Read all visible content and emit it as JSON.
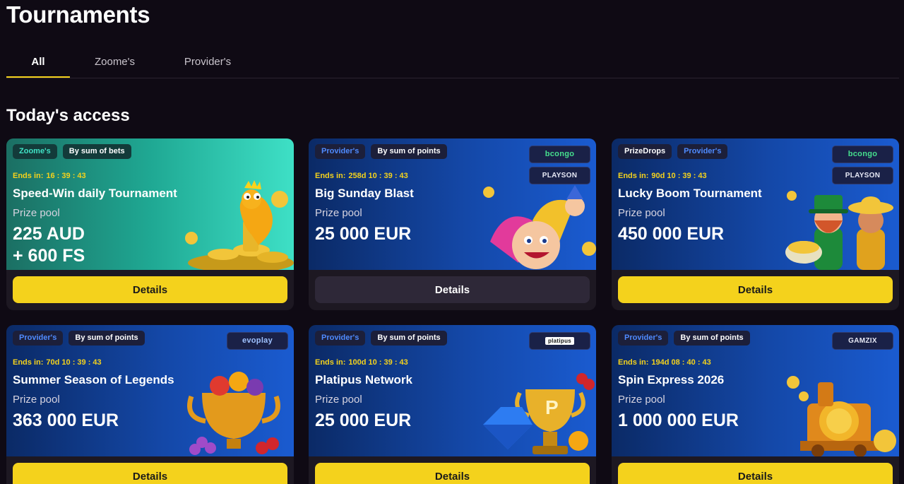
{
  "page": {
    "title": "Tournaments",
    "section_title": "Today's access"
  },
  "tabs": [
    {
      "label": "All",
      "active": true
    },
    {
      "label": "Zoome's",
      "active": false
    },
    {
      "label": "Provider's",
      "active": false
    }
  ],
  "colors": {
    "accent": "#f4d21c",
    "background": "#0f0a14",
    "provider_tag": "#4f8bff",
    "zoome_tag": "#41e3c6"
  },
  "cards": [
    {
      "tags": [
        "Zoome's",
        "By sum of bets"
      ],
      "ends_label": "Ends in:",
      "ends_time": "16 : 39 : 43",
      "title": "Speed-Win daily Tournament",
      "prize_label": "Prize pool",
      "prize_line1": "225 AUD",
      "prize_line2": "+ 600 FS",
      "providers": [],
      "button": "Details",
      "button_style": "primary",
      "art": "gecko-coins-icon"
    },
    {
      "tags": [
        "Provider's",
        "By sum of points"
      ],
      "ends_label": "Ends in:",
      "ends_time": "258d 10 : 39 : 43",
      "title": "Big Sunday Blast",
      "prize_label": "Prize pool",
      "prize_line1": "25 000 EUR",
      "prize_line2": "",
      "providers": [
        "bcongo",
        "PLAYSON"
      ],
      "button": "Details",
      "button_style": "secondary",
      "art": "jester-icon"
    },
    {
      "tags": [
        "PrizeDrops",
        "Provider's"
      ],
      "ends_label": "Ends in:",
      "ends_time": "90d 10 : 39 : 43",
      "title": "Lucky Boom Tournament",
      "prize_label": "Prize pool",
      "prize_line1": "450 000 EUR",
      "prize_line2": "",
      "providers": [
        "bcongo",
        "PLAYSON"
      ],
      "button": "Details",
      "button_style": "primary",
      "art": "leprechaun-icon"
    },
    {
      "tags": [
        "Provider's",
        "By sum of points"
      ],
      "ends_label": "Ends in:",
      "ends_time": "70d 10 : 39 : 43",
      "title": "Summer Season of Legends",
      "prize_label": "Prize pool",
      "prize_line1": "363 000 EUR",
      "prize_line2": "",
      "providers": [
        "evoplay"
      ],
      "button": "Details",
      "button_style": "primary",
      "art": "fruit-trophy-icon"
    },
    {
      "tags": [
        "Provider's",
        "By sum of points"
      ],
      "ends_label": "Ends in:",
      "ends_time": "100d 10 : 39 : 43",
      "title": "Platipus Network",
      "prize_label": "Prize pool",
      "prize_line1": "25 000 EUR",
      "prize_line2": "",
      "providers": [
        "platipus"
      ],
      "button": "Details",
      "button_style": "primary",
      "art": "gem-trophy-icon"
    },
    {
      "tags": [
        "Provider's",
        "By sum of points"
      ],
      "ends_label": "Ends in:",
      "ends_time": "194d 08 : 40 : 43",
      "title": "Spin Express 2026",
      "prize_label": "Prize pool",
      "prize_line1": "1 000 000 EUR",
      "prize_line2": "",
      "providers": [
        "GAMZIX"
      ],
      "button": "Details",
      "button_style": "primary",
      "art": "train-coins-icon"
    }
  ]
}
